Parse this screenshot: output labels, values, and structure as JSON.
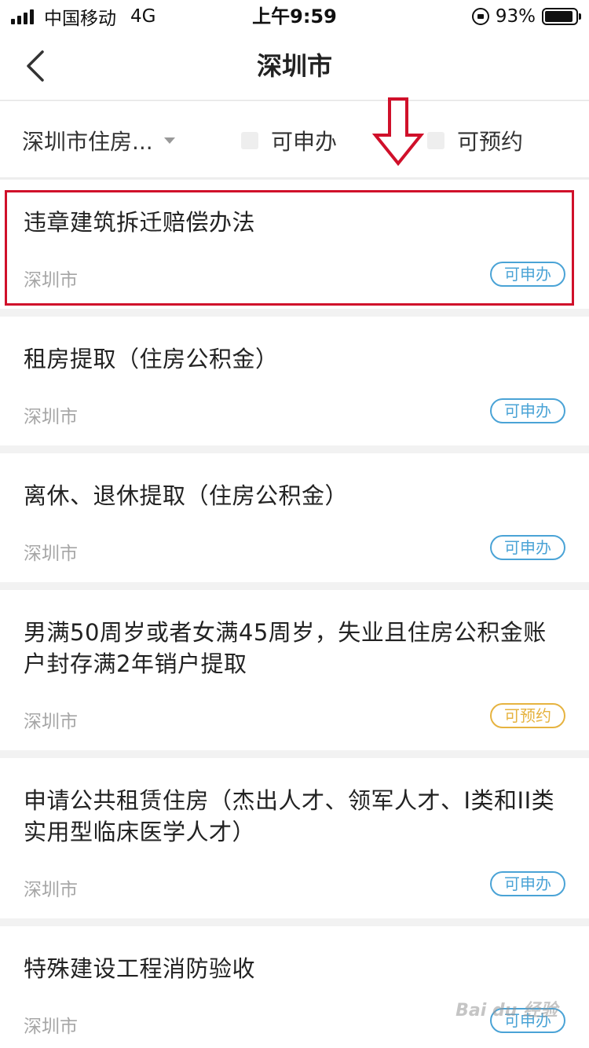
{
  "status": {
    "carrier": "中国移动",
    "network": "4G",
    "time": "上午9:59",
    "battery": "93%",
    "battery_level": 0.93
  },
  "nav": {
    "title": "深圳市"
  },
  "filters": {
    "dropdown_label": "深圳市住房...",
    "apply_label": "可申办",
    "reserve_label": "可预约"
  },
  "items": [
    {
      "title": "违章建筑拆迁赔偿办法",
      "city": "深圳市",
      "tag": "可申办"
    },
    {
      "title": "租房提取（住房公积金）",
      "city": "深圳市",
      "tag": "可申办"
    },
    {
      "title": "离休、退休提取（住房公积金）",
      "city": "深圳市",
      "tag": "可申办"
    },
    {
      "title": "男满50周岁或者女满45周岁，失业且住房公积金账户封存满2年销户提取",
      "city": "深圳市",
      "tag": "可预约"
    },
    {
      "title": "申请公共租赁住房（杰出人才、领军人才、I类和II类实用型临床医学人才）",
      "city": "深圳市",
      "tag": "可申办"
    },
    {
      "title": "特殊建设工程消防验收",
      "city": "深圳市",
      "tag": "可申办"
    }
  ],
  "colors": {
    "accent_blue": "#4aa3d6",
    "accent_yellow": "#e6b340",
    "highlight_red": "#d0102a"
  },
  "watermark": "Bai du 经验"
}
